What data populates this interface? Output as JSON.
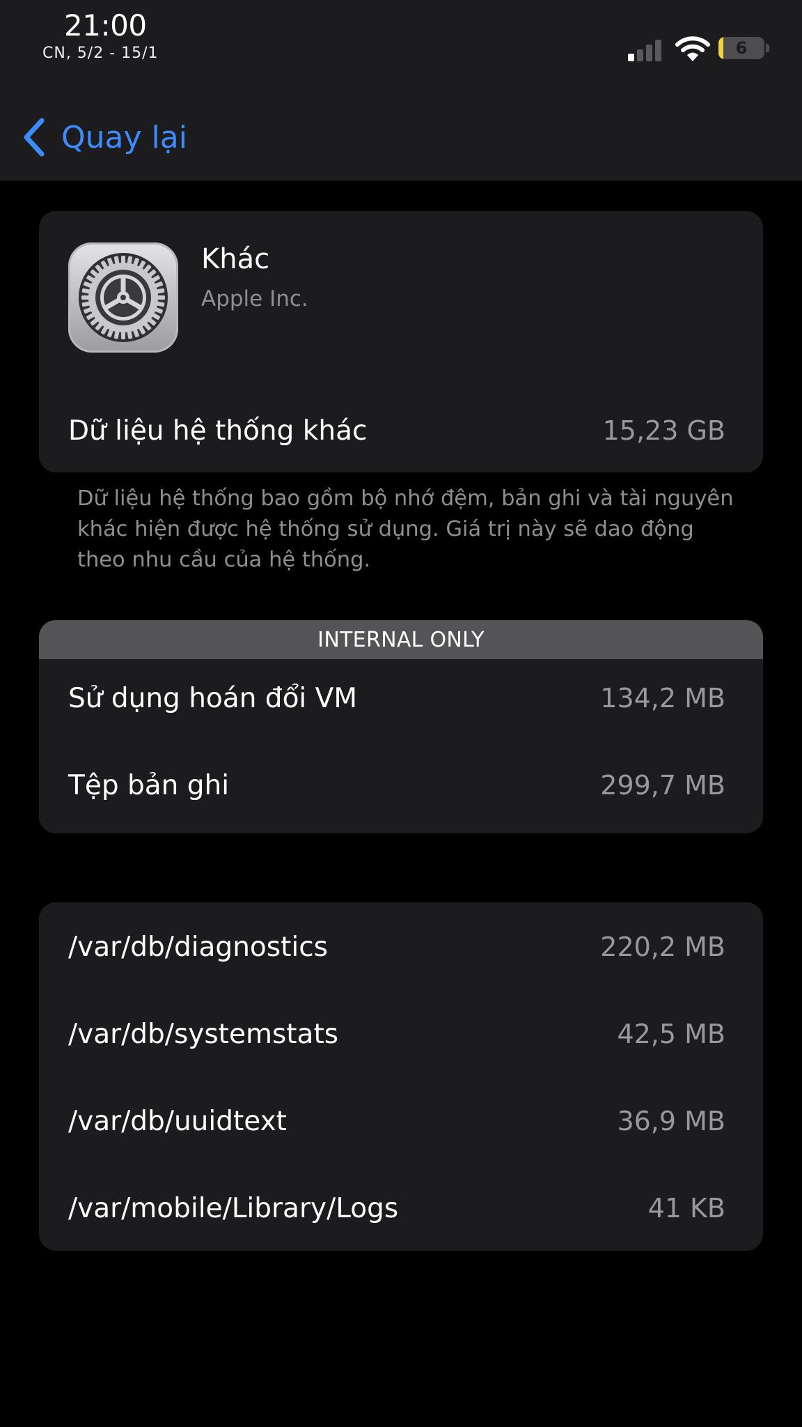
{
  "status_bar": {
    "time": "21:00",
    "date": "CN, 5/2 - 15/1",
    "battery_level": "6",
    "signal_bars_active": 1,
    "signal_bars_total": 4
  },
  "nav": {
    "back_label": "Quay lại",
    "accent_color": "#3d8bfd"
  },
  "app": {
    "icon": "settings-gear-icon",
    "name": "Khác",
    "developer": "Apple Inc.",
    "system_data_label": "Dữ liệu hệ thống khác",
    "system_data_value": "15,23 GB"
  },
  "note": "Dữ liệu hệ thống bao gồm bộ nhớ đệm, bản ghi và tài nguyên khác hiện được hệ thống sử dụng. Giá trị này sẽ dao động theo nhu cầu của hệ thống.",
  "internal": {
    "header": "INTERNAL ONLY",
    "rows": [
      {
        "label": "Sử dụng hoán đổi VM",
        "value": "134,2 MB"
      },
      {
        "label": "Tệp bản ghi",
        "value": "299,7 MB"
      }
    ]
  },
  "paths": [
    {
      "label": "/var/db/diagnostics",
      "value": "220,2 MB"
    },
    {
      "label": "/var/db/systemstats",
      "value": "42,5 MB"
    },
    {
      "label": "/var/db/uuidtext",
      "value": "36,9 MB"
    },
    {
      "label": "/var/mobile/Library/Logs",
      "value": "41 KB"
    }
  ]
}
